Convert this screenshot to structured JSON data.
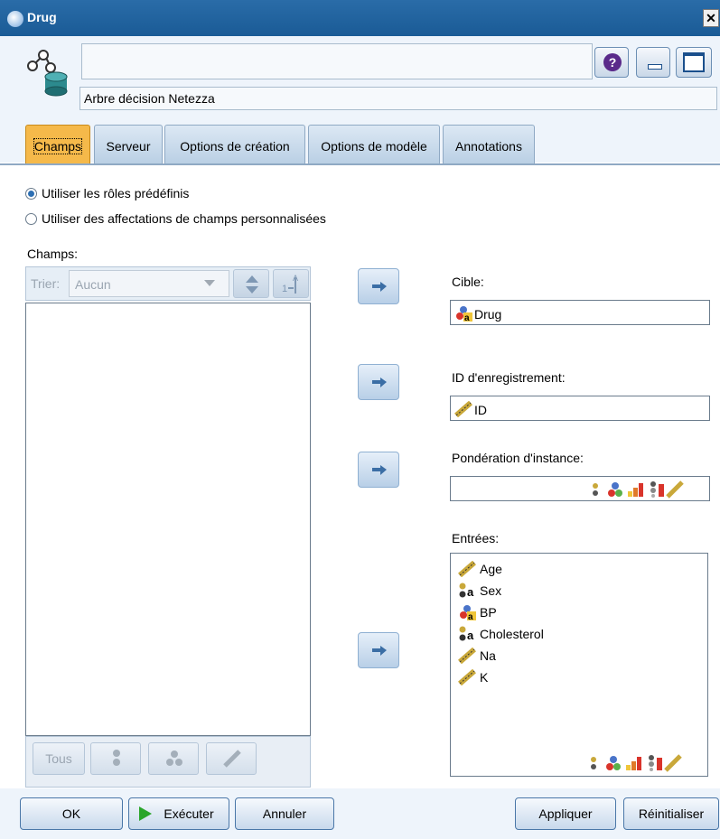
{
  "window": {
    "title": "Drug",
    "close_glyph": "✕"
  },
  "header": {
    "node_name": "",
    "node_annotation": "Arbre décision Netezza",
    "help_glyph": "?"
  },
  "tabs": [
    {
      "label": "Champs",
      "active": true
    },
    {
      "label": "Serveur"
    },
    {
      "label": "Options de création"
    },
    {
      "label": "Options de modèle"
    },
    {
      "label": "Annotations"
    }
  ],
  "roles": {
    "predefined_label": "Utiliser les rôles prédéfinis",
    "custom_label": "Utiliser des affectations de champs personnalisées",
    "selected": "predefined"
  },
  "fields_panel": {
    "label": "Champs:",
    "sort_label": "Trier:",
    "sort_value": "Aucun",
    "az_glyph": "A",
    "buttons": {
      "all": "Tous"
    }
  },
  "target": {
    "label": "Cible:",
    "value": "Drug"
  },
  "record_id": {
    "label": "ID d'enregistrement:",
    "value": "ID"
  },
  "weight": {
    "label": "Pondération d'instance:",
    "value": ""
  },
  "inputs": {
    "label": "Entrées:",
    "items": [
      {
        "name": "Age",
        "icon": "continuous-ruler-icon"
      },
      {
        "name": "Sex",
        "icon": "flag-text-icon"
      },
      {
        "name": "BP",
        "icon": "nominal-text-icon"
      },
      {
        "name": "Cholesterol",
        "icon": "flag-text-icon"
      },
      {
        "name": "Na",
        "icon": "continuous-ruler-icon"
      },
      {
        "name": "K",
        "icon": "continuous-ruler-icon"
      }
    ]
  },
  "footer": {
    "ok": "OK",
    "run": "Exécuter",
    "cancel": "Annuler",
    "apply": "Appliquer",
    "reset": "Réinitialiser"
  },
  "colors": {
    "accent_tab": "#f5b94a",
    "titlebar": "#1a5b96",
    "run_icon": "#2aa52a"
  }
}
